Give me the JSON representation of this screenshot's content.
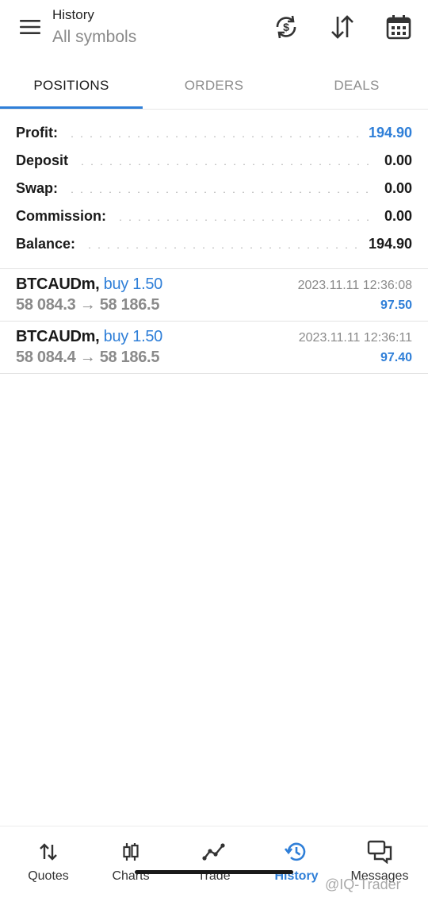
{
  "header": {
    "title": "History",
    "subtitle": "All symbols",
    "icons": [
      "menu-icon",
      "currency-exchange-icon",
      "sort-icon",
      "calendar-icon"
    ]
  },
  "tabs": [
    {
      "label": "POSITIONS",
      "active": true
    },
    {
      "label": "ORDERS",
      "active": false
    },
    {
      "label": "DEALS",
      "active": false
    }
  ],
  "summary": [
    {
      "label": "Profit:",
      "value": "194.90",
      "accent": true
    },
    {
      "label": "Deposit",
      "value": "0.00",
      "accent": false
    },
    {
      "label": "Swap:",
      "value": "0.00",
      "accent": false
    },
    {
      "label": "Commission:",
      "value": "0.00",
      "accent": false
    },
    {
      "label": "Balance:",
      "value": "194.90",
      "accent": false
    }
  ],
  "trades": [
    {
      "symbol": "BTCAUDm,",
      "side": "buy 1.50",
      "open": "58 084.3",
      "arrow": "→",
      "close": "58 186.5",
      "time": "2023.11.11 12:36:08",
      "profit": "97.50"
    },
    {
      "symbol": "BTCAUDm,",
      "side": "buy 1.50",
      "open": "58 084.4",
      "arrow": "→",
      "close": "58 186.5",
      "time": "2023.11.11 12:36:11",
      "profit": "97.40"
    }
  ],
  "bottom_nav": [
    {
      "label": "Quotes",
      "icon": "quotes-icon",
      "active": false
    },
    {
      "label": "Charts",
      "icon": "candlestick-icon",
      "active": false
    },
    {
      "label": "Trade",
      "icon": "trade-line-icon",
      "active": false
    },
    {
      "label": "History",
      "icon": "history-icon",
      "active": true
    },
    {
      "label": "Messages",
      "icon": "messages-icon",
      "active": false
    }
  ],
  "watermark": "@IQ-Trader",
  "colors": {
    "accent": "#2f7fd8",
    "text": "#1a1a1a",
    "muted": "#8a8a8a"
  }
}
